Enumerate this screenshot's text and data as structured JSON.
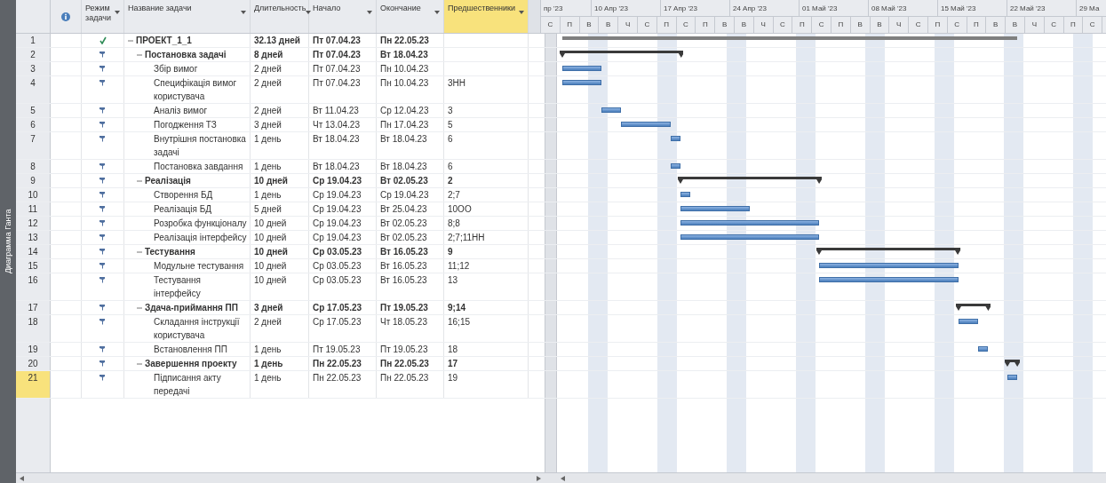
{
  "side_label": "Диаграмма Ганта",
  "columns": [
    {
      "label": "Режим задачи",
      "selected": false
    },
    {
      "label": "Название задачи",
      "selected": false
    },
    {
      "label": "Длительность",
      "selected": false
    },
    {
      "label": "Начало",
      "selected": false
    },
    {
      "label": "Окончание",
      "selected": false
    },
    {
      "label": "Предшественники",
      "selected": true
    }
  ],
  "timescale": {
    "weeks": [
      "пр '23",
      "10 Апр '23",
      "17 Апр '23",
      "24 Апр '23",
      "01 Май '23",
      "08 Май '23",
      "15 Май '23",
      "22 Май '23",
      "29 Ма"
    ],
    "days": [
      "С",
      "П",
      "В",
      "В",
      "Ч",
      "С",
      "П",
      "С",
      "П",
      "В",
      "В",
      "Ч",
      "С",
      "П",
      "С",
      "П",
      "В",
      "В",
      "Ч",
      "С",
      "П",
      "С",
      "П",
      "В",
      "В",
      "Ч",
      "С",
      "П",
      "С"
    ]
  },
  "tasks": [
    {
      "id": "1",
      "kind": "project",
      "expanded": true,
      "name": "ПРОЕКТ_1_1",
      "duration": "32.13 дней",
      "start": "Пт 07.04.23",
      "finish": "Пн 22.05.23",
      "selected": false,
      "children": [
        {
          "id": "2",
          "kind": "summary",
          "expanded": true,
          "name": "Постановка задачі",
          "duration": "8 дней",
          "start": "Пт 07.04.23",
          "finish": "Вт 18.04.23",
          "selected": false,
          "children": [
            {
              "id": "3",
              "kind": "task",
              "name": "Збір вимог",
              "duration": "2 дней",
              "start": "Пт 07.04.23",
              "finish": "Пн 10.04.23",
              "selected": false
            },
            {
              "id": "4",
              "kind": "task",
              "name": "Специфікація вимог користувача",
              "duration": "2 дней",
              "start": "Пт 07.04.23",
              "finish": "Пн 10.04.23",
              "predecessors": "3НН",
              "selected": false
            },
            {
              "id": "5",
              "kind": "task",
              "name": "Аналіз вимог",
              "duration": "2 дней",
              "start": "Вт 11.04.23",
              "finish": "Ср 12.04.23",
              "predecessors": "3",
              "selected": false
            },
            {
              "id": "6",
              "kind": "task",
              "name": "Погодження ТЗ",
              "duration": "3 дней",
              "start": "Чт 13.04.23",
              "finish": "Пн 17.04.23",
              "predecessors": "5",
              "selected": false
            },
            {
              "id": "7",
              "kind": "task",
              "name": "Внутрішня постановка задачі",
              "duration": "1 день",
              "start": "Вт 18.04.23",
              "finish": "Вт 18.04.23",
              "predecessors": "6",
              "selected": false
            },
            {
              "id": "8",
              "kind": "task",
              "name": "Постановка завдання",
              "duration": "1 день",
              "start": "Вт 18.04.23",
              "finish": "Вт 18.04.23",
              "predecessors": "6",
              "selected": false
            }
          ]
        },
        {
          "id": "9",
          "kind": "summary",
          "expanded": true,
          "name": "Реалізація",
          "duration": "10 дней",
          "start": "Ср 19.04.23",
          "finish": "Вт 02.05.23",
          "predecessors": "2",
          "selected": false,
          "children": [
            {
              "id": "10",
              "kind": "task",
              "name": "Створення БД",
              "duration": "1 день",
              "start": "Ср 19.04.23",
              "finish": "Ср 19.04.23",
              "predecessors": "2;7",
              "selected": false
            },
            {
              "id": "11",
              "kind": "task",
              "name": "Реалізація БД",
              "duration": "5 дней",
              "start": "Ср 19.04.23",
              "finish": "Вт 25.04.23",
              "predecessors": "10ОО",
              "selected": false
            },
            {
              "id": "12",
              "kind": "task",
              "name": "Розробка функціоналу",
              "duration": "10 дней",
              "start": "Ср 19.04.23",
              "finish": "Вт 02.05.23",
              "predecessors": "8;8",
              "selected": false
            },
            {
              "id": "13",
              "kind": "task",
              "name": "Реалізація інтерфейсу",
              "duration": "10 дней",
              "start": "Ср 19.04.23",
              "finish": "Вт 02.05.23",
              "predecessors": "2;7;11НН",
              "selected": false
            }
          ]
        },
        {
          "id": "14",
          "kind": "summary",
          "expanded": true,
          "name": "Тестування",
          "duration": "10 дней",
          "start": "Ср 03.05.23",
          "finish": "Вт 16.05.23",
          "predecessors": "9",
          "selected": false,
          "children": [
            {
              "id": "15",
              "kind": "task",
              "name": "Модульне тестування",
              "duration": "10 дней",
              "start": "Ср 03.05.23",
              "finish": "Вт 16.05.23",
              "predecessors": "11;12",
              "selected": false
            },
            {
              "id": "16",
              "kind": "task",
              "name": "Тестування інтерфейсу",
              "duration": "10 дней",
              "start": "Ср 03.05.23",
              "finish": "Вт 16.05.23",
              "predecessors": "13",
              "selected": false
            }
          ]
        },
        {
          "id": "17",
          "kind": "summary",
          "expanded": true,
          "name": "Здача-приймання ПП",
          "duration": "3 дней",
          "start": "Ср 17.05.23",
          "finish": "Пт 19.05.23",
          "predecessors": "9;14",
          "selected": false,
          "children": [
            {
              "id": "18",
              "kind": "task",
              "name": "Складання інструкції користувача",
              "duration": "2 дней",
              "start": "Ср 17.05.23",
              "finish": "Чт 18.05.23",
              "predecessors": "16;15",
              "selected": false
            },
            {
              "id": "19",
              "kind": "task",
              "name": "Встановлення ПП",
              "duration": "1 день",
              "start": "Пт 19.05.23",
              "finish": "Пт 19.05.23",
              "predecessors": "18",
              "selected": false
            }
          ]
        },
        {
          "id": "20",
          "kind": "summary",
          "expanded": true,
          "name": "Завершення проекту",
          "duration": "1 день",
          "start": "Пн 22.05.23",
          "finish": "Пн 22.05.23",
          "predecessors": "17",
          "selected": false,
          "children": [
            {
              "id": "21",
              "kind": "task",
              "name": "Підписання акту передачі",
              "duration": "1 день",
              "start": "Пн 22.05.23",
              "finish": "Пн 22.05.23",
              "predecessors": "19",
              "selected": true
            }
          ]
        }
      ]
    }
  ]
}
